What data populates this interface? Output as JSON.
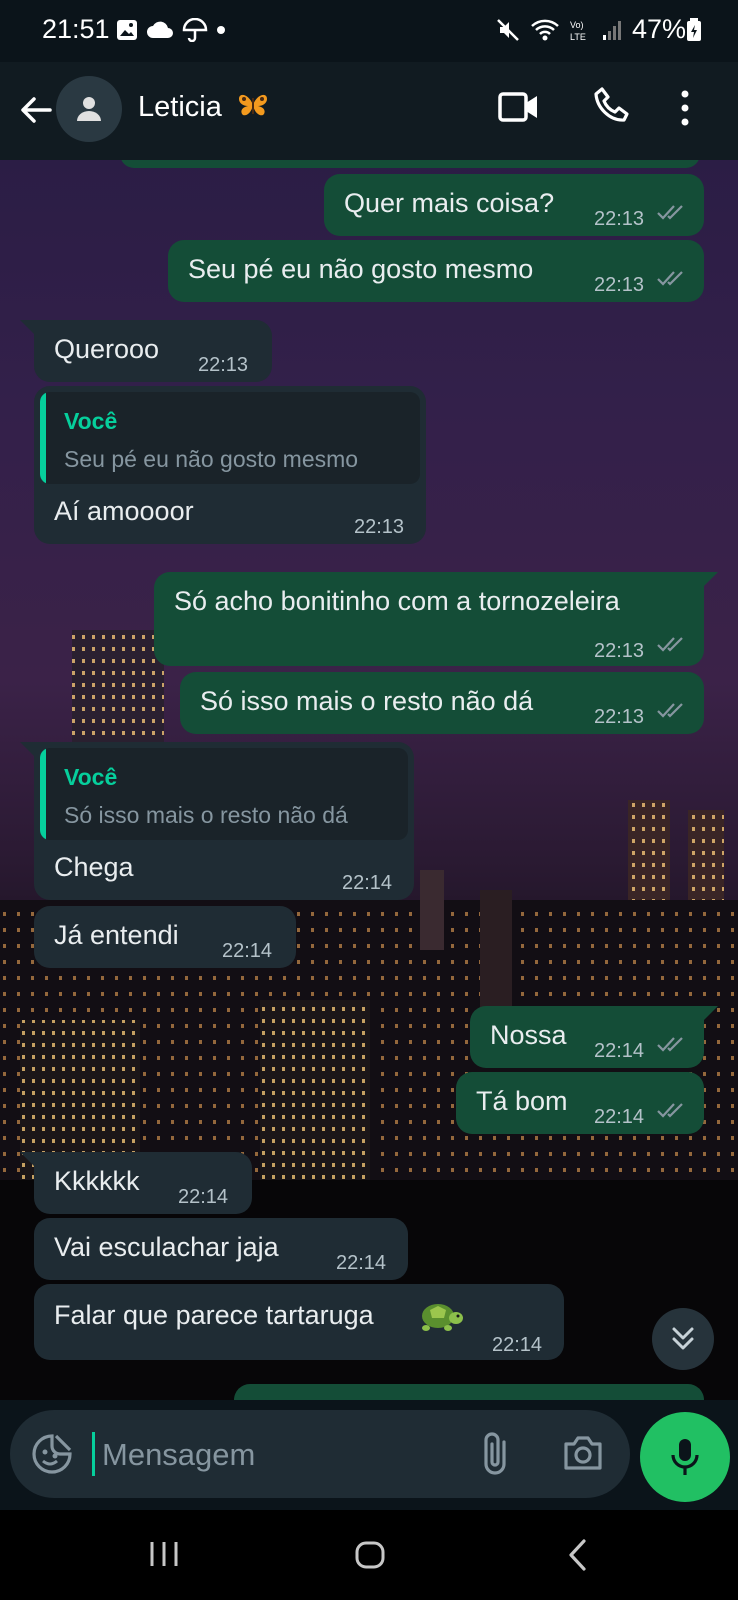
{
  "status_bar": {
    "time": "21:51",
    "battery": "47%"
  },
  "header": {
    "contact_name": "Leticia"
  },
  "messages": [
    {
      "text": "Quer mais coisa?",
      "time": "22:13",
      "direction": "out"
    },
    {
      "text": "Seu pé eu não gosto mesmo",
      "time": "22:13",
      "direction": "out"
    },
    {
      "text": "Querooo",
      "time": "22:13",
      "direction": "in"
    },
    {
      "text": "Aí amoooor",
      "time": "22:13",
      "direction": "in",
      "quote": {
        "author": "Você",
        "text": "Seu pé eu não gosto mesmo"
      }
    },
    {
      "text": "Só acho bonitinho com a tornozeleira",
      "time": "22:13",
      "direction": "out"
    },
    {
      "text": "Só isso mais o resto não dá",
      "time": "22:13",
      "direction": "out"
    },
    {
      "text": "Chega",
      "time": "22:14",
      "direction": "in",
      "quote": {
        "author": "Você",
        "text": "Só isso mais o resto não dá"
      }
    },
    {
      "text": "Já entendi",
      "time": "22:14",
      "direction": "in"
    },
    {
      "text": "Nossa",
      "time": "22:14",
      "direction": "out"
    },
    {
      "text": "Tá bom",
      "time": "22:14",
      "direction": "out"
    },
    {
      "text": "Kkkkkk",
      "time": "22:14",
      "direction": "in"
    },
    {
      "text": "Vai esculachar jaja",
      "time": "22:14",
      "direction": "in"
    },
    {
      "text": "Falar que parece tartaruga",
      "time": "22:14",
      "direction": "in",
      "emoji": "turtle"
    }
  ],
  "input": {
    "placeholder": "Mensagem"
  },
  "colors": {
    "outgoing_bubble": "#144d37",
    "incoming_bubble": "#1f2c34",
    "accent": "#06cf9c",
    "mic_button": "#21c063"
  },
  "icons": [
    "back-arrow-icon",
    "avatar-icon",
    "butterfly-emoji",
    "video-call-icon",
    "phone-icon",
    "more-vert-icon",
    "double-check-icon",
    "turtle-emoji",
    "scroll-down-icon",
    "sticker-icon",
    "paperclip-icon",
    "camera-icon",
    "mic-icon"
  ]
}
